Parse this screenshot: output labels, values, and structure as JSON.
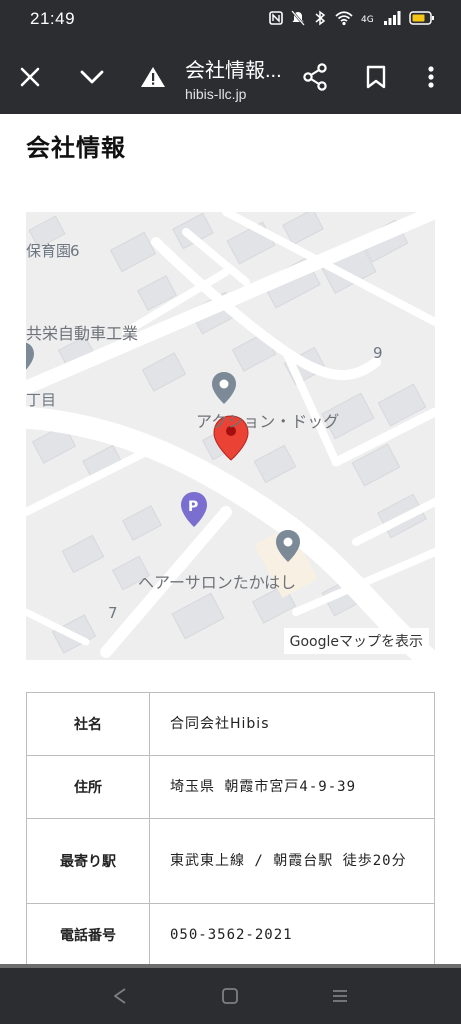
{
  "status_bar": {
    "time": "21:49",
    "icons": [
      "nfc-icon",
      "mute-icon",
      "bluetooth-icon",
      "wifi-icon",
      "volte-icon",
      "signal-icon",
      "battery-icon"
    ]
  },
  "toolbar": {
    "title": "会社情報...",
    "url": "hibis-llc.jp",
    "icons": [
      "close-icon",
      "chevron-down-icon",
      "warning-icon",
      "share-icon",
      "bookmark-icon",
      "more-vert-icon"
    ]
  },
  "page": {
    "title": "会社情報"
  },
  "map": {
    "labels": {
      "nursery": "保育園",
      "block6": "6",
      "company": "共栄自動車工業",
      "block9": "9",
      "chome": "丁目",
      "place_dog": "アクション・ドッグ",
      "place_salon": "ヘアーサロンたかはし",
      "block7": "7"
    },
    "view_button": "Googleマップを表示",
    "colors": {
      "background": "#eeeeef",
      "road": "#ffffff",
      "marker": "#ea4335",
      "poi_pin": "#7b8a96",
      "parking_pin": "#7a6fd0"
    }
  },
  "company_table": {
    "rows": [
      {
        "label": "社名",
        "value": "合同会社Hibis"
      },
      {
        "label": "住所",
        "value": "埼玉県 朝霞市宮戸4-9-39"
      },
      {
        "label": "最寄り駅",
        "value": "東武東上線 / 朝霞台駅 徒歩20分"
      },
      {
        "label": "電話番号",
        "value": "050-3562-2021"
      }
    ]
  },
  "nav_bar": {
    "icons": [
      "back-icon",
      "home-icon",
      "recents-icon"
    ]
  }
}
